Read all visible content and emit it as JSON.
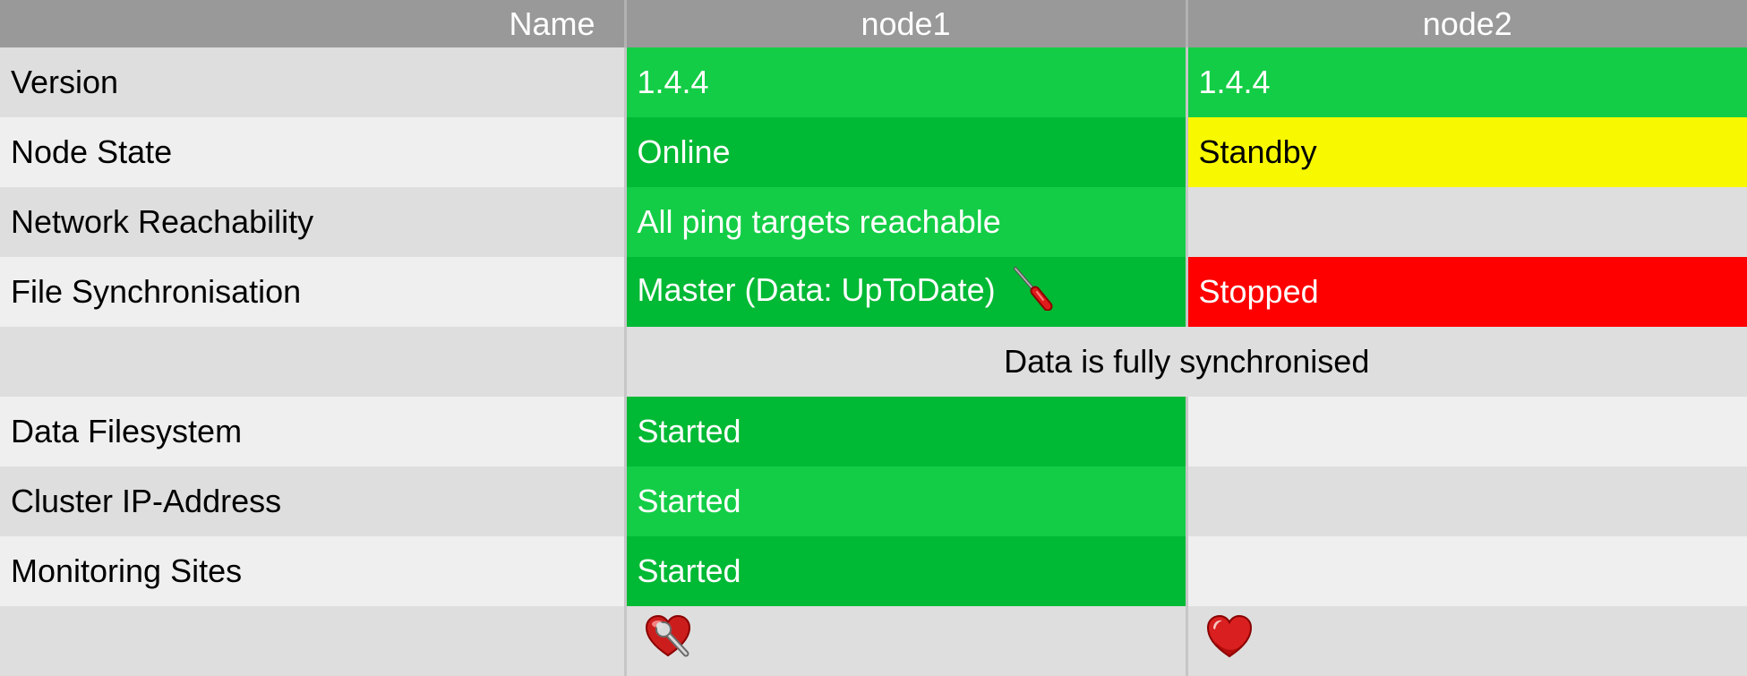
{
  "header": {
    "name": "Name",
    "node1": "node1",
    "node2": "node2"
  },
  "rows": [
    {
      "label": "Version",
      "node1": "1.4.4",
      "node2": "1.4.4"
    },
    {
      "label": "Node State",
      "node1": "Online",
      "node2": "Standby"
    },
    {
      "label": "Network Reachability",
      "node1": "All ping targets reachable",
      "node2": ""
    },
    {
      "label": "File Synchronisation",
      "node1": "Master (Data: UpToDate)",
      "node2": "Stopped"
    },
    {
      "label": "",
      "merged": "Data is fully synchronised"
    },
    {
      "label": "Data Filesystem",
      "node1": "Started",
      "node2": ""
    },
    {
      "label": "Cluster IP-Address",
      "node1": "Started",
      "node2": ""
    },
    {
      "label": "Monitoring Sites",
      "node1": "Started",
      "node2": ""
    }
  ],
  "icons": {
    "file_sync_action": "wrench-icon",
    "node1_action": "heart-wrench-icon",
    "node2_action": "heart-icon"
  },
  "colors": {
    "ok_light": "#14cd46",
    "ok_dark": "#00b934",
    "warning": "#f8f800",
    "critical": "#ff0000",
    "header": "#999999"
  }
}
